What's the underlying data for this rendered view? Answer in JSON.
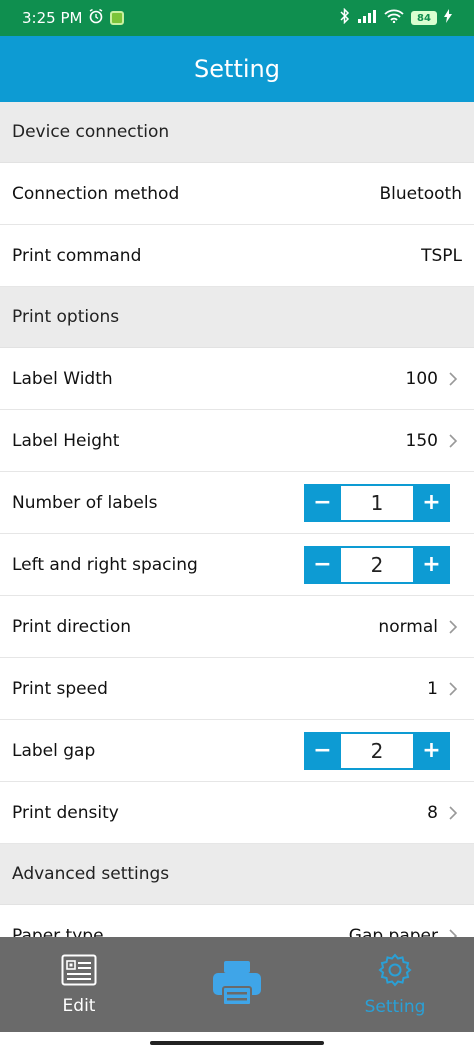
{
  "status_bar": {
    "time": "3:25 PM",
    "battery": "84"
  },
  "header": {
    "title": "Setting"
  },
  "sections": {
    "device": {
      "title": "Device connection",
      "connection_method": {
        "label": "Connection method",
        "value": "Bluetooth"
      },
      "print_command": {
        "label": "Print command",
        "value": "TSPL"
      }
    },
    "print_options": {
      "title": "Print options",
      "label_width": {
        "label": "Label Width",
        "value": "100"
      },
      "label_height": {
        "label": "Label Height",
        "value": "150"
      },
      "number_of_labels": {
        "label": "Number of labels",
        "value": "1"
      },
      "spacing": {
        "label": "Left and right spacing",
        "value": "2"
      },
      "print_direction": {
        "label": "Print direction",
        "value": "normal"
      },
      "print_speed": {
        "label": "Print speed",
        "value": "1"
      },
      "label_gap": {
        "label": "Label gap",
        "value": "2"
      },
      "print_density": {
        "label": "Print density",
        "value": "8"
      }
    },
    "advanced": {
      "title": "Advanced settings",
      "paper_type": {
        "label": "Paper type",
        "value": "Gap paper"
      }
    }
  },
  "stepper": {
    "minus": "−",
    "plus": "+"
  },
  "bottom_nav": {
    "edit_label": "Edit",
    "setting_label": "Setting"
  },
  "colors": {
    "accent": "#0d9bd3",
    "status_bar": "#0f8f4f",
    "nav_bg": "#6a6a6a"
  }
}
